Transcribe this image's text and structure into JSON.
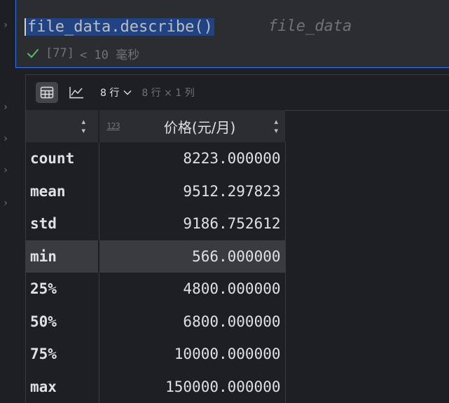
{
  "cell": {
    "code": "file_data.describe()",
    "inline_hint": "file_data",
    "exec_count": "[77]",
    "exec_time": "< 10 毫秒",
    "status_icon": "check-icon"
  },
  "toolbar": {
    "table_view_icon": "table-icon",
    "chart_view_icon": "chart-icon",
    "rows_label": "8 行",
    "dims_label": "8 行 × 1 列"
  },
  "table": {
    "index_header": "",
    "column": {
      "type_icon": "123",
      "name": "价格(元/月)"
    },
    "rows": [
      {
        "index": "count",
        "value": "8223.000000"
      },
      {
        "index": "mean",
        "value": "9512.297823"
      },
      {
        "index": "std",
        "value": "9186.752612"
      },
      {
        "index": "min",
        "value": "566.000000"
      },
      {
        "index": "25%",
        "value": "4800.000000"
      },
      {
        "index": "50%",
        "value": "6800.000000"
      },
      {
        "index": "75%",
        "value": "10000.000000"
      },
      {
        "index": "max",
        "value": "150000.000000"
      }
    ]
  },
  "colors": {
    "selection": "#214283",
    "accent": "#3574f0",
    "success": "#5fb865"
  }
}
